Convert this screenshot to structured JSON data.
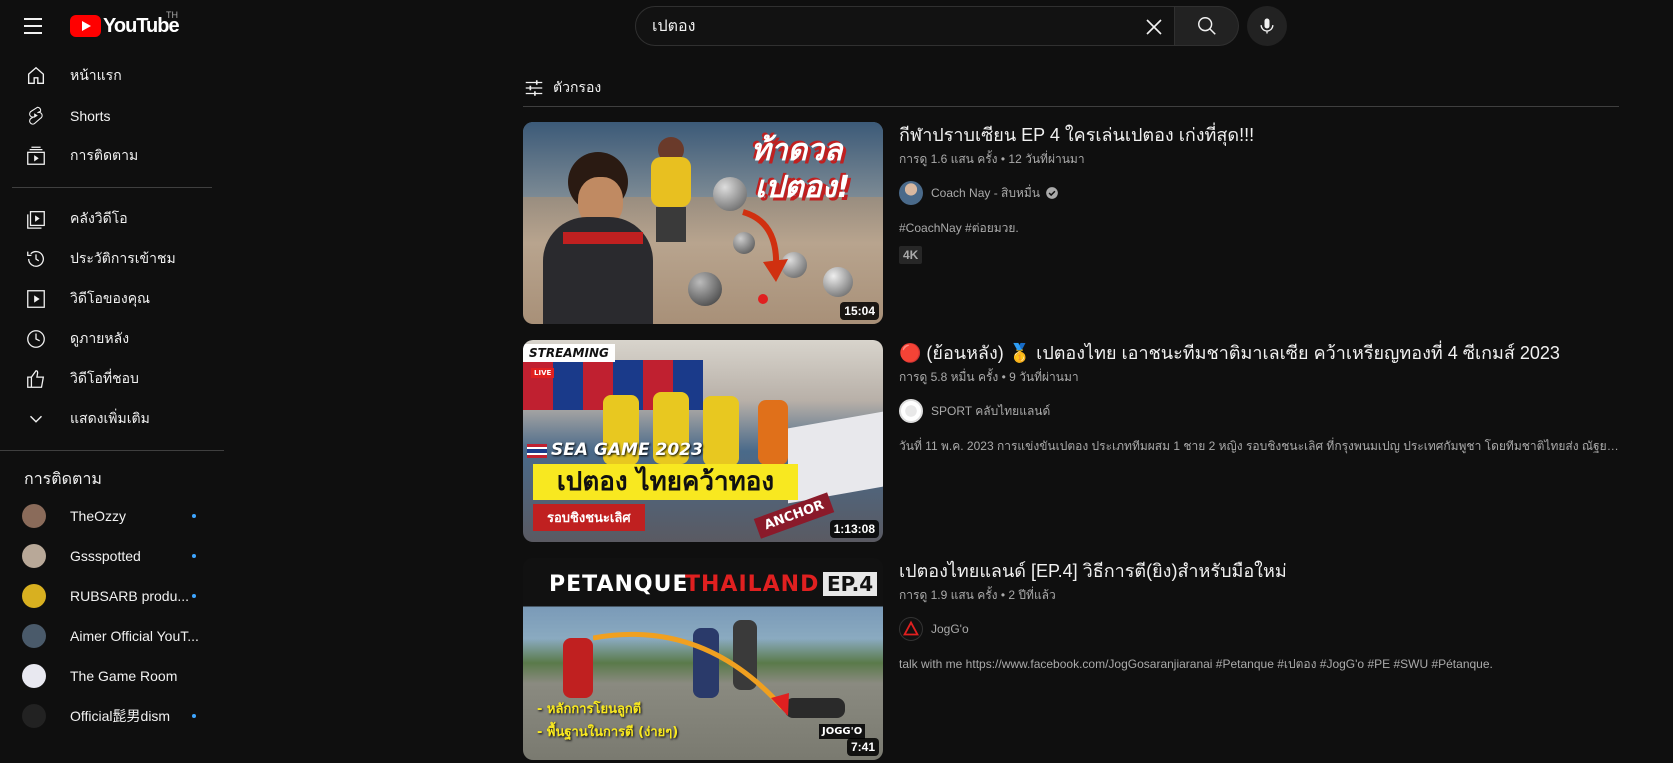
{
  "header": {
    "logo_text": "YouTube",
    "country_code": "TH",
    "search_value": "เปตอง"
  },
  "sidebar": {
    "main": [
      {
        "label": "หน้าแรก",
        "icon": "home-icon"
      },
      {
        "label": "Shorts",
        "icon": "shorts-icon"
      },
      {
        "label": "การติดตาม",
        "icon": "subscriptions-icon"
      }
    ],
    "you": [
      {
        "label": "คลังวิดีโอ",
        "icon": "library-icon"
      },
      {
        "label": "ประวัติการเข้าชม",
        "icon": "history-icon"
      },
      {
        "label": "วิดีโอของคุณ",
        "icon": "your-videos-icon"
      },
      {
        "label": "ดูภายหลัง",
        "icon": "watch-later-icon"
      },
      {
        "label": "วิดีโอที่ชอบ",
        "icon": "liked-icon"
      },
      {
        "label": "แสดงเพิ่มเติม",
        "icon": "chevron-down-icon"
      }
    ],
    "subscriptions_title": "การติดตาม",
    "subscriptions": [
      {
        "name": "TheOzzy",
        "new": true,
        "color": "#8a6b5a"
      },
      {
        "name": "Gssspotted",
        "new": true,
        "color": "#b8a898"
      },
      {
        "name": "RUBSARB produ...",
        "new": true,
        "color": "#d8b020"
      },
      {
        "name": "Aimer Official YouT...",
        "new": false,
        "color": "#4a5a6a"
      },
      {
        "name": "The Game Room",
        "new": false,
        "color": "#e8e8f0"
      },
      {
        "name": "Official髭男dism",
        "new": true,
        "color": "#222222"
      }
    ]
  },
  "filter_label": "ตัวกรอง",
  "results": [
    {
      "title": "กีฬาปราบเซียน EP 4 ใครเล่นเปตอง เก่งที่สุด!!!",
      "views": "การดู 1.6 แสน ครั้ง",
      "age": "12 วันที่ผ่านมา",
      "channel": "Coach Nay - สิบหมื่น",
      "verified": true,
      "description": "#CoachNay #ต่อยมวย.",
      "badge": "4K",
      "duration": "15:04",
      "thumb_text": [
        "ท้าดวล",
        "เปตอง!"
      ]
    },
    {
      "title": "🔴 (ย้อนหลัง) 🥇 เปตองไทย เอาชนะทีมชาติมาเลเซีย คว้าเหรียญทองที่ 4 ซีเกมส์ 2023",
      "views": "การดู 5.8 หมื่น ครั้ง",
      "age": "9 วันที่ผ่านมา",
      "channel": "SPORT คลับไทยแลนด์",
      "verified": false,
      "description": "วันที่ 11 พ.ค. 2023 การแข่งขันเปตอง ประเภททีมผสม 1 ชาย 2 หญิง รอบชิงชนะเลิศ ที่กรุงพนมเปญ ประเทศกัมพูชา โดยทีมชาติไทยส่ง ณัฐยา ...",
      "badge": "",
      "duration": "1:13:08",
      "thumb_text": [
        "STREAMING",
        "LIVE",
        "SEA GAME 2023",
        "เปตอง ไทยคว้าทอง",
        "รอบชิงชนะเลิศ",
        "ANCHOR"
      ]
    },
    {
      "title": "เปตองไทยแลนด์ [EP.4] วิธีการตี(ยิง)สำหรับมือใหม่",
      "views": "การดู 1.9 แสน ครั้ง",
      "age": "2 ปีที่แล้ว",
      "channel": "JogG'o",
      "verified": false,
      "description": "talk with me https://www.facebook.com/JogGosaranjiaranai #Petanque #เปตอง #JogG'o #PE #SWU #Pétanque.",
      "badge": "",
      "duration": "7:41",
      "thumb_text": [
        "PETANQUE",
        "THAILAND",
        "EP.4",
        "- หลักการโยนลูกตี",
        "- พื้นฐานในการตี (ง่ายๆ)",
        "JOGG'O"
      ]
    }
  ]
}
